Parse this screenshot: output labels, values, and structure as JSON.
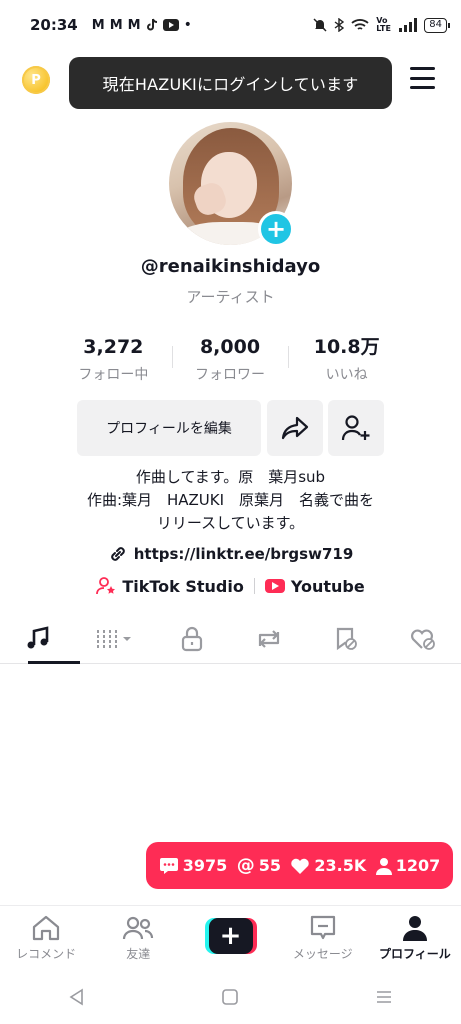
{
  "status_bar": {
    "time": "20:34",
    "notification_icons": [
      "M",
      "M",
      "M"
    ],
    "right_text": "Vo LTE",
    "battery": "84"
  },
  "header": {
    "coin_label": "P",
    "toast": "現在HAZUKIにログインしています"
  },
  "profile": {
    "username": "@renaikinshidayo",
    "role": "アーティスト",
    "stats": [
      {
        "value": "3,272",
        "label": "フォロー中"
      },
      {
        "value": "8,000",
        "label": "フォロワー"
      },
      {
        "value": "10.8万",
        "label": "いいね"
      }
    ],
    "edit_button": "プロフィールを編集",
    "bio_lines": [
      "作曲してます。原　葉月sub",
      "作曲:葉月　HAZUKI　原葉月　名義で曲を",
      "リリースしています。"
    ],
    "link": "https://linktr.ee/brgsw719",
    "external": {
      "studio": "TikTok Studio",
      "youtube": "Youtube"
    }
  },
  "tabs": [
    {
      "icon": "music-note-icon"
    },
    {
      "icon": "grid-filter-icon"
    },
    {
      "icon": "lock-icon"
    },
    {
      "icon": "repost-icon"
    },
    {
      "icon": "bookmark-hidden-icon"
    },
    {
      "icon": "liked-hidden-icon"
    }
  ],
  "notification_pill": {
    "comments": "3975",
    "mentions": "55",
    "likes": "23.5K",
    "followers": "1207"
  },
  "bottom_nav": {
    "home": "レコメンド",
    "friends": "友達",
    "inbox": "メッセージ",
    "profile": "プロフィール"
  },
  "colors": {
    "accent": "#fe2c55",
    "cyan": "#25f4ee",
    "badge": "#20c5e4"
  }
}
